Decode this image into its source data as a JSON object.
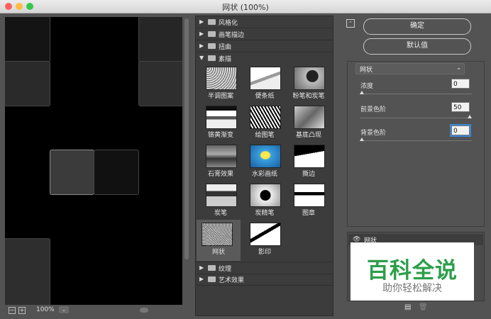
{
  "window": {
    "title": "网状 (100%)"
  },
  "preview": {
    "zoom": "100%"
  },
  "gallery": {
    "categories": [
      {
        "label": "风格化",
        "expanded": false
      },
      {
        "label": "画笔描边",
        "expanded": false
      },
      {
        "label": "扭曲",
        "expanded": false
      },
      {
        "label": "素描",
        "expanded": true
      },
      {
        "label": "纹理",
        "expanded": false
      },
      {
        "label": "艺术效果",
        "expanded": false
      }
    ],
    "filters": [
      "半调图案",
      "便条纸",
      "粉笔和炭笔",
      "铬黄渐变",
      "绘图笔",
      "基底凸现",
      "石膏效果",
      "水彩画纸",
      "撕边",
      "炭笔",
      "炭精笔",
      "图章",
      "网状",
      "影印"
    ],
    "selected": "网状"
  },
  "buttons": {
    "ok": "确定",
    "defaults": "默认值"
  },
  "filter_select": {
    "value": "网状"
  },
  "params": [
    {
      "label": "浓度",
      "value": "0",
      "level": 0
    },
    {
      "label": "前景色阶",
      "value": "50",
      "level": 1.0
    },
    {
      "label": "背景色阶",
      "value": "0",
      "level": 0
    }
  ],
  "layers": {
    "item": "网状"
  },
  "watermark": {
    "line1": "百科全说",
    "line2": "助你轻松解决"
  },
  "icons": {
    "eye": "eye-icon",
    "new_layer": "new-layer-icon",
    "trash": "trash-icon"
  }
}
